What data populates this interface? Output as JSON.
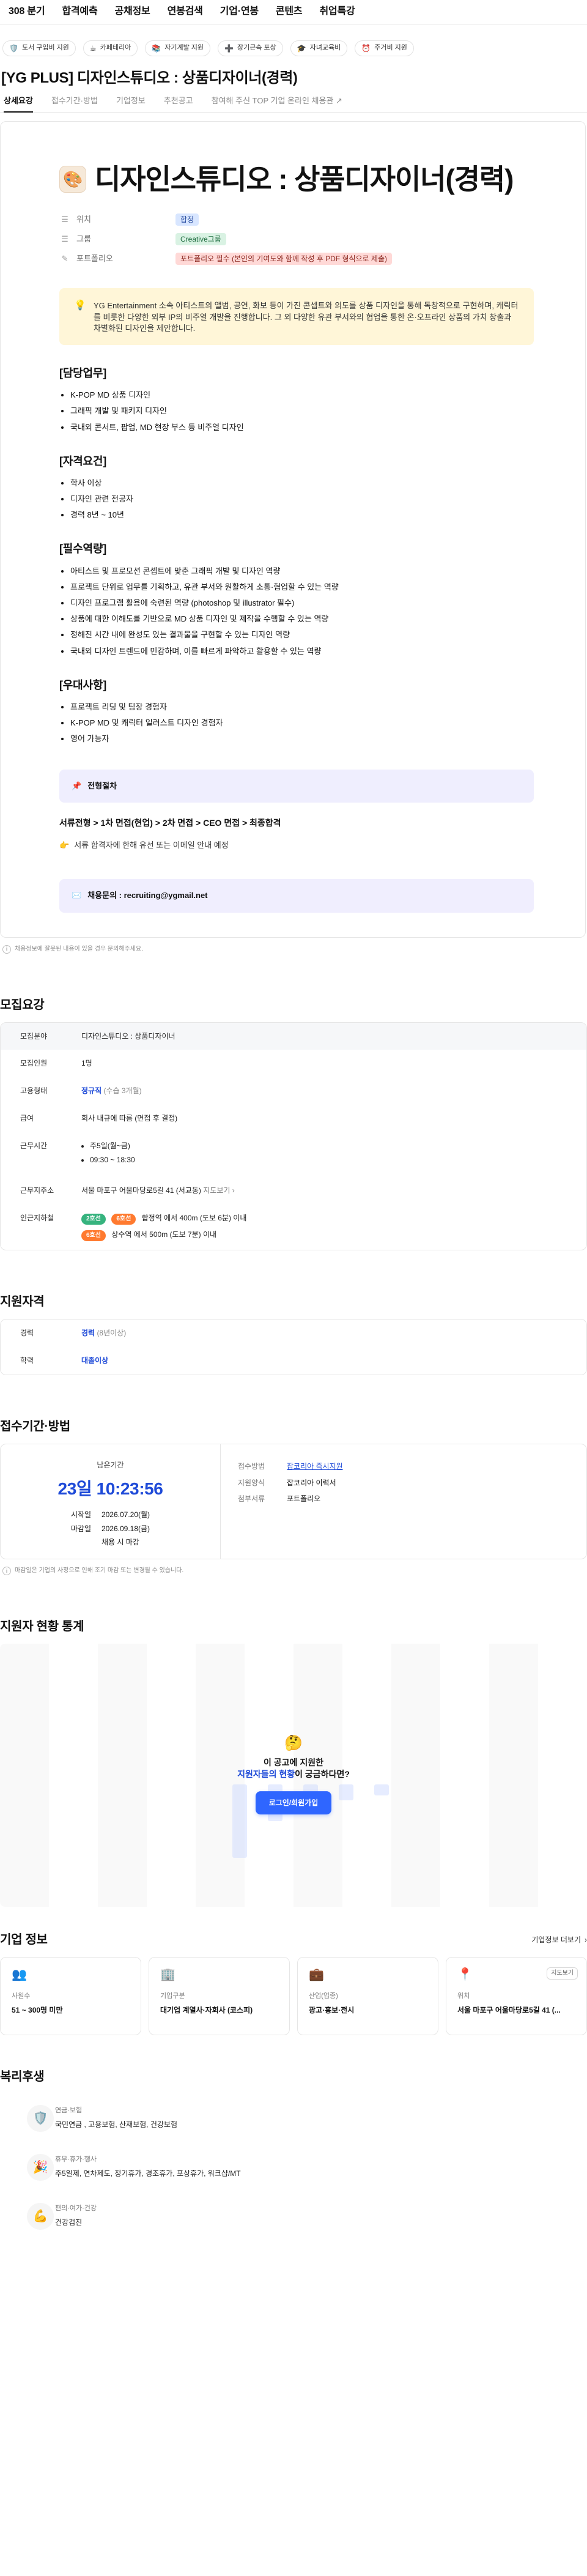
{
  "topnav": {
    "items": [
      "308 분기",
      "합격예측",
      "공채정보",
      "연봉검색",
      "기업·연봉",
      "콘텐츠",
      "취업특강"
    ]
  },
  "chips": [
    {
      "icon": "🛡️",
      "label": "도서 구입비 지원"
    },
    {
      "icon": "☕",
      "label": "카페테리아"
    },
    {
      "icon": "📚",
      "label": "자기계발 지원"
    },
    {
      "icon": "➕",
      "label": "장기근속 포상"
    },
    {
      "icon": "🎓",
      "label": "자녀교육비"
    },
    {
      "icon": "⏰",
      "label": "주거비 지원"
    }
  ],
  "header": {
    "title": "[YG PLUS] 디자인스튜디오 : 상품디자이너(경력)"
  },
  "tabs": [
    {
      "label": "상세요강",
      "active": true
    },
    {
      "label": "접수기간·방법",
      "active": false
    },
    {
      "label": "기업정보",
      "active": false
    },
    {
      "label": "추천공고",
      "active": false
    },
    {
      "label": "참여해 주신 TOP 기업 온라인 채용관",
      "active": false
    }
  ],
  "post": {
    "title": "디자인스튜디오 : 상품디자이너(경력)",
    "properties": [
      {
        "key": "위치",
        "value": "합정",
        "tag": "blue",
        "icon": "☰"
      },
      {
        "key": "그룹",
        "value": "Creative그룹",
        "tag": "green",
        "icon": "☰"
      },
      {
        "key": "포트폴리오",
        "value": "포트폴리오 필수 (본인의 기여도와 함께 작성 후 PDF 형식으로 제출)",
        "tag": "red",
        "icon": "✎"
      }
    ],
    "intro": "YG Entertainment 소속 아티스트의 앨범, 공연, 화보 등이 가진 콘셉트와 의도를 상품 디자인을 통해 독창적으로 구현하며, 캐릭터를 비롯한 다양한 외부 IP의 비주얼 개발을 진행합니다. 그 외 다양한 유관 부서와의 협업을 통한 온·오프라인 상품의 가치 창출과 차별화된 디자인을 제안합니다.",
    "sections": [
      {
        "title": "[담당업무]",
        "items": [
          "K-POP MD 상품 디자인",
          "그래픽 개발 및 패키지 디자인",
          "국내외 콘서트, 팝업, MD 현장 부스 등 비주얼 디자인"
        ]
      },
      {
        "title": "[자격요건]",
        "items": [
          "학사 이상",
          "디자인 관련 전공자",
          "경력 8년 ~ 10년"
        ]
      },
      {
        "title": "[필수역량]",
        "items": [
          "아티스트 및 프로모션 콘셉트에 맞춘 그래픽 개발 및 디자인 역량",
          "프로젝트 단위로 업무를 기획하고, 유관 부서와 원활하게 소통·협업할 수 있는 역량",
          "디자인 프로그램 활용에 숙련된 역량 (photoshop 및 illustrator 필수)",
          "상품에 대한 이해도를 기반으로 MD 상품 디자인 및 제작을 수행할 수 있는 역량",
          "정해진 시간 내에 완성도 있는 결과물을 구현할 수 있는 디자인 역량",
          "국내외 디자인 트렌드에 민감하며, 이를 빠르게 파악하고 활용할 수 있는 역량"
        ]
      },
      {
        "title": "[우대사항]",
        "items": [
          "프로젝트 리딩 및 팀장 경험자",
          "K-POP MD 및 캐릭터 일러스트 디자인 경험자",
          "영어 가능자"
        ]
      }
    ],
    "callout": "전형절차",
    "process": "서류전형 > 1차 면접(현업) > 2차 면접 > CEO 면접 > 최종합격",
    "note": "서류 합격자에 한해 유선 또는 이메일 안내 예정",
    "contact": "채용문의 : recruiting@ygmail.net",
    "fineprint": "채용정보에 잘못된 내용이 있을 경우 문의해주세요."
  },
  "recruitment": {
    "title": "모집요강",
    "rows": [
      {
        "k": "모집분야",
        "v": "디자인스튜디오 : 상품디자이너"
      },
      {
        "k": "모집인원",
        "v": "1명"
      },
      {
        "k": "고용형태",
        "v_blue": "정규직",
        "v_sub": "(수습 3개월)"
      },
      {
        "k": "급여",
        "v": "회사 내규에 따름 (면접 후 결정)"
      },
      {
        "k": "근무시간",
        "list": [
          "주5일(월~금)",
          "09:30 ~ 18:30"
        ]
      },
      {
        "k": "근무지주소",
        "v": "서울 마포구 어울마당로5길 41 (서교동)",
        "link": "지도보기"
      },
      {
        "k": "인근지하철",
        "lines": [
          {
            "pills": [
              {
                "t": "2호선",
                "c": "green"
              },
              {
                "t": "6호선",
                "c": "orange"
              }
            ],
            "text": "합정역 에서 400m (도보 6분) 이내"
          },
          {
            "pills": [
              {
                "t": "6호선",
                "c": "orange"
              }
            ],
            "text": "상수역 에서 500m (도보 7분) 이내"
          }
        ]
      }
    ]
  },
  "qualification": {
    "title": "지원자격",
    "rows": [
      {
        "k": "경력",
        "v_blue": "경력",
        "v_sub": "(8년이상)"
      },
      {
        "k": "학력",
        "v_blue": "대졸이상"
      }
    ]
  },
  "apply": {
    "title": "접수기간·방법",
    "left": {
      "small": "남은기간",
      "big": "23일 10:23:56",
      "start_k": "시작일",
      "start_v": "2026.07.20(월)",
      "end_k": "마감일",
      "end_v": "2026.09.18(금)",
      "end_note": "채용 시 마감"
    },
    "right": [
      {
        "k": "접수방법",
        "v_link": "잡코리아 즉시지원"
      },
      {
        "k": "지원양식",
        "v": "잡코리아 이력서"
      },
      {
        "k": "첨부서류",
        "v": "포트폴리오"
      }
    ],
    "fineprint": "마감일은 기업의 사정으로 인해 조기 마감 또는 변경될 수 있습니다."
  },
  "stats": {
    "title": "지원자 현황 통계",
    "overlay_line1": "이 공고에 지원한",
    "overlay_line2_blue": "지원자들의 현황",
    "overlay_line2_suffix": "이 궁금하다면?",
    "button": "로그인/회원가입"
  },
  "company": {
    "title": "기업 정보",
    "more": "기업정보 더보기",
    "cards": [
      {
        "icon": "👥",
        "label": "사원수",
        "value": "51 ~ 300명 미만"
      },
      {
        "icon": "🏢",
        "label": "기업구분",
        "value": "대기업 계열사·자회사 (코스피)"
      },
      {
        "icon": "💼",
        "label": "산업(업종)",
        "value": "광고·홍보·전시"
      },
      {
        "icon": "📍",
        "label": "위치",
        "value": "서울 마포구 어울마당로5길 41 (...",
        "map": "지도보기"
      }
    ]
  },
  "welfare": {
    "title": "복리후생",
    "items": [
      {
        "icon": "🛡️",
        "title": "연금·보험",
        "text": "국민연금 , 고용보험, 산재보험, 건강보험"
      },
      {
        "icon": "🎉",
        "title": "휴무·휴가·행사",
        "text": "주5일제, 연차제도, 정기휴가, 경조휴가, 포상휴가, 워크샵/MT"
      },
      {
        "icon": "💪",
        "title": "편의·여가·건강",
        "text": "건강검진"
      }
    ]
  }
}
